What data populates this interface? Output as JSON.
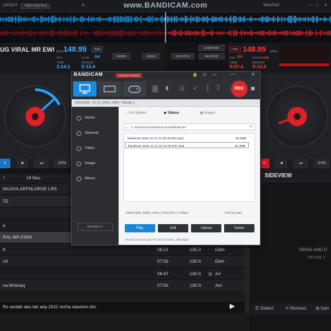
{
  "topbar": {
    "left_label": "LAYOUT",
    "mode_select": "TWO DECKS",
    "right_label": "MASTER"
  },
  "watermark": {
    "brand": "www.BANDICAM.com"
  },
  "deck_left": {
    "title": "UG VIRAL  MR EWI",
    "bpm": "148.95",
    "bpm_label": "BPM",
    "tap": "TAP",
    "time_label": "TIME",
    "time": "3:14.1",
    "remain_label": "REMAIN",
    "remain": "5:13.4",
    "key_label": "KEY",
    "key": "A#",
    "gain_label": "GAIN",
    "gain": "0.0dB",
    "btn_mixer": "MIXER",
    "btn_video": "VIDEO",
    "btn_scratch": "SCRATCH",
    "btn_sampler": "SAMPLER",
    "btn_master": "MASTER"
  },
  "deck_right": {
    "tap": "TAP",
    "bpm": "148.95",
    "bpm_label": "BPM",
    "time_label": "TIME",
    "time": "5:07.4",
    "remain_label": "REMAIN",
    "remain": "5:13.4",
    "key_label": "KEY",
    "key": "A#",
    "gain_label": "GAIN",
    "gain": "0.0dB"
  },
  "transport_left": [
    "E",
    "■",
    "⏭",
    "SYN"
  ],
  "transport_right": [
    "E",
    "■",
    "⏭",
    "SYN"
  ],
  "browser": {
    "file_count": "19 files",
    "rows": [
      {
        "title": "WIJAYA  ARFNLORSE LRS",
        "time": "",
        "bpm": "",
        "key": ""
      },
      {
        "title": "TE",
        "time": "",
        "bpm": "",
        "key": ""
      },
      {
        "title": "",
        "time": "",
        "bpm": "",
        "key": ""
      },
      {
        "title": "a",
        "time": "",
        "bpm": "",
        "key": ""
      },
      {
        "title": "RAL  MR EWIK",
        "time": "",
        "bpm": "",
        "key": ""
      },
      {
        "title": "K",
        "time": "06:21",
        "bpm": "135.0",
        "key": "Ddm"
      },
      {
        "title": "o3",
        "time": "07:55",
        "bpm": "130.0",
        "key": "Ebm"
      },
      {
        "title": "",
        "time": "06:47",
        "bpm": "130.0",
        "key": "A#"
      },
      {
        "title": "na  Mrlshaq",
        "time": "07:50",
        "bpm": "130.0",
        "key": "Am"
      }
    ],
    "now_playing": "Rs  seolah aku tak ada 2021  rezha stavems  brc"
  },
  "sideview": {
    "title": "SIDEVIEW",
    "drop_text": "DRAG AND D",
    "drop_sub": "OR USE T",
    "btn_sidelist": "Sidelist",
    "btn_remixes": "Remixes",
    "btn_sampler": "Sam"
  },
  "bandicam": {
    "app_name": "BANDICAM",
    "tag_unregistered": "UNREGISTERED",
    "rec_label": "REC",
    "info": "1920x1080 - (0, 0), (1920, 1080) - Display 1",
    "nav": [
      "Home",
      "General",
      "Video",
      "Image",
      "About"
    ],
    "tabs": [
      "Get Started",
      "Videos",
      "Images"
    ],
    "path": "C:\\Users\\coconut\\Documents\\Bandicam",
    "files": [
      {
        "name": "bandicam 2021-11-11 01-49-33-381.mp4",
        "size": "39.2MB"
      },
      {
        "name": "bandicam 2021-11-11 01-43-40-047.mp4",
        "size": "82.3MB"
      }
    ],
    "file_meta": "1920x1080, 30fps, H264 | 00:04:09 | 4.7Mbps",
    "sort_label": "Sort by Date",
    "buttons": [
      "Play",
      "Edit",
      "Upload",
      "Delete"
    ],
    "side_button": "BANDICUT",
    "footer": "How to record your PC for 24 hours, 365 days"
  }
}
